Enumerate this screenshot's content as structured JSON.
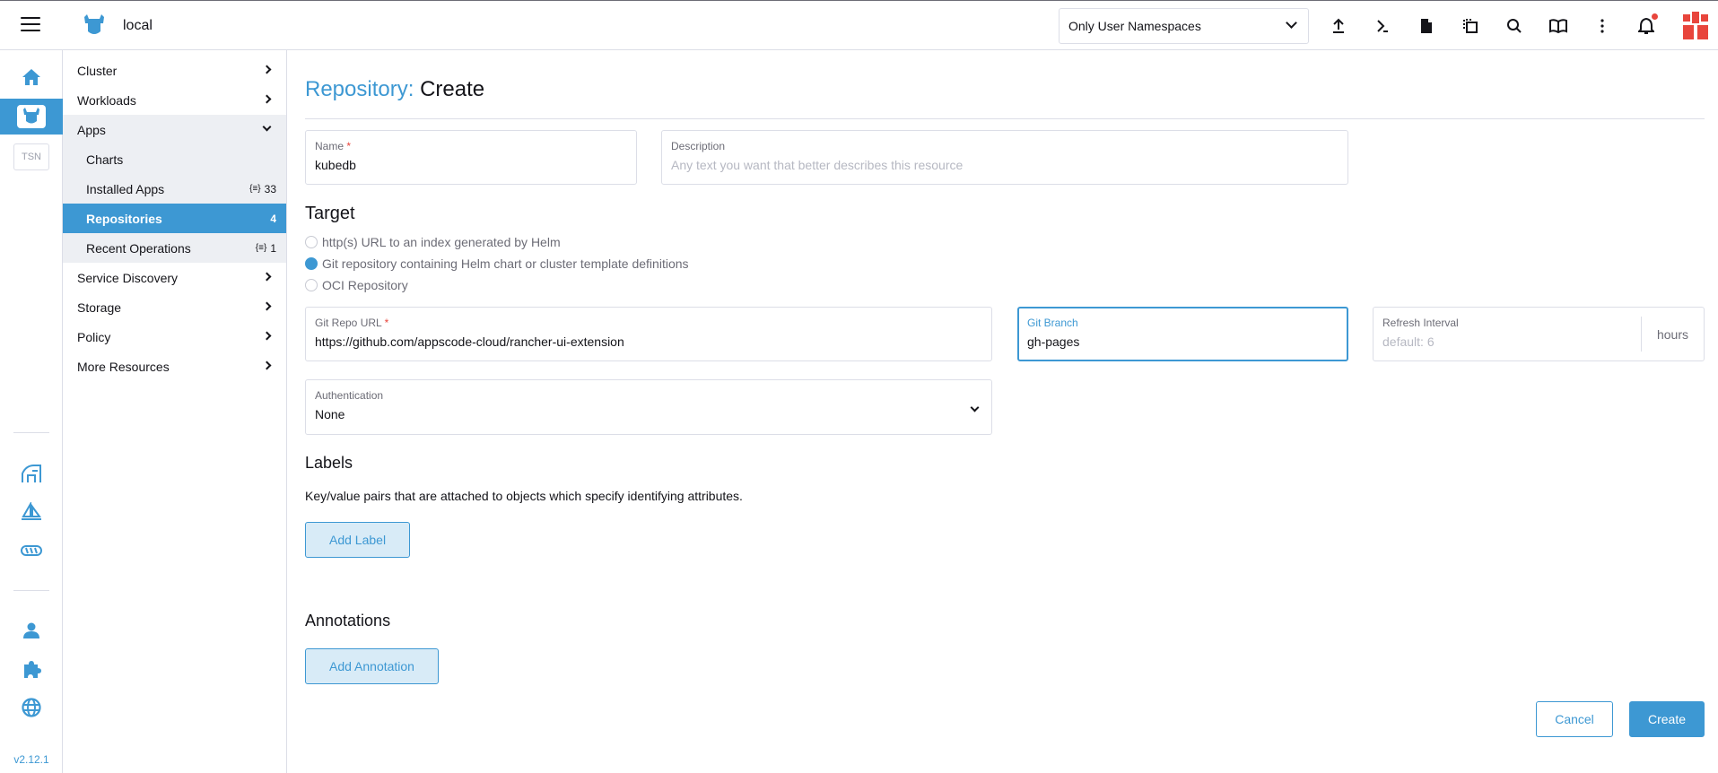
{
  "header": {
    "cluster_name": "local",
    "namespace_filter": "Only User Namespaces",
    "icons": [
      "upload-icon",
      "kubectl-shell-icon",
      "file-icon",
      "copy-config-icon",
      "search-icon",
      "docs-book-icon",
      "more-vert-icon",
      "bell-icon",
      "user-avatar"
    ]
  },
  "rail": {
    "tsn_label": "TSN",
    "version": "v2.12.1"
  },
  "sidenav": {
    "groups": [
      {
        "label": "Cluster"
      },
      {
        "label": "Workloads"
      },
      {
        "label": "Apps"
      },
      {
        "label": "Service Discovery"
      },
      {
        "label": "Storage"
      },
      {
        "label": "Policy"
      },
      {
        "label": "More Resources"
      }
    ],
    "apps_children": [
      {
        "label": "Charts",
        "count": ""
      },
      {
        "label": "Installed Apps",
        "count": "33"
      },
      {
        "label": "Repositories",
        "count": "4"
      },
      {
        "label": "Recent Operations",
        "count": "1"
      }
    ]
  },
  "page": {
    "title_crumb": "Repository:",
    "title_action": "Create",
    "name_label": "Name",
    "name_value": "kubedb",
    "description_label": "Description",
    "description_placeholder": "Any text you want that better describes this resource",
    "target_title": "Target",
    "target_options": [
      {
        "label": "http(s) URL to an index generated by Helm",
        "selected": false
      },
      {
        "label": "Git repository containing Helm chart or cluster template definitions",
        "selected": true
      },
      {
        "label": "OCI Repository",
        "selected": false
      }
    ],
    "git_repo_label": "Git Repo URL",
    "git_repo_value": "https://github.com/appscode-cloud/rancher-ui-extension",
    "git_branch_label": "Git Branch",
    "git_branch_value": "gh-pages",
    "refresh_label": "Refresh Interval",
    "refresh_placeholder": "default: 6",
    "refresh_suffix": "hours",
    "auth_label": "Authentication",
    "auth_value": "None",
    "labels_title": "Labels",
    "labels_help": "Key/value pairs that are attached to objects which specify identifying attributes.",
    "add_label_button": "Add Label",
    "annotations_title": "Annotations",
    "add_annotation_button": "Add Annotation",
    "cancel_button": "Cancel",
    "create_button": "Create",
    "required_mark": "*"
  },
  "colors": {
    "accent": "#3d98d3",
    "required": "#e8453c",
    "border": "#dcdee7"
  }
}
